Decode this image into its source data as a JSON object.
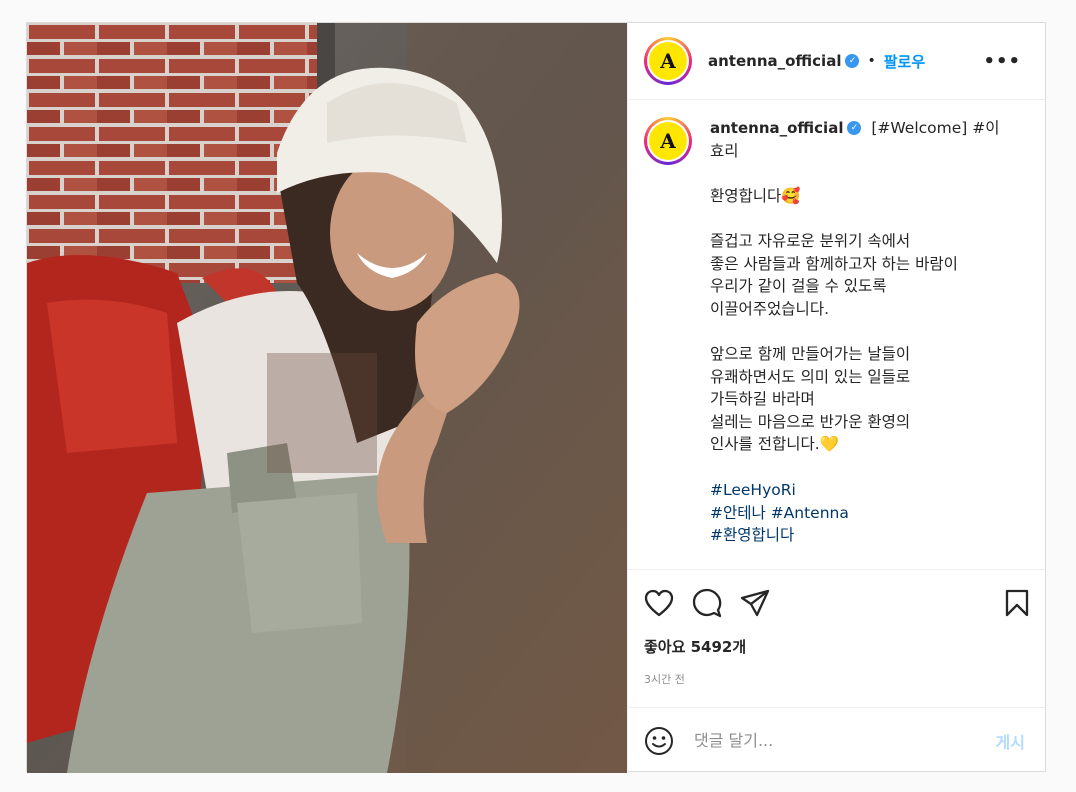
{
  "header": {
    "username": "antenna_official",
    "verified_mark": "✓",
    "separator": "•",
    "follow_label": "팔로우",
    "more_label": "•••",
    "avatar_letter": "A"
  },
  "caption": {
    "username": "antenna_official",
    "verified_mark": "✓",
    "text": "[#Welcome] #이효리\n\n환영합니다🥰\n\n즐겁고 자유로운 분위기 속에서\n좋은 사람들과 함께하고자 하는 바람이\n우리가 같이 걸을 수 있도록\n이끌어주었습니다.\n\n앞으로 함께 만들어가는 날들이\n유쾌하면서도 의미 있는 일들로\n가득하길 바라며\n설레는 마음으로 반가운 환영의\n인사를 전합니다.💛",
    "hashtags": [
      "#LeeHyoRi",
      "#안테나 #Antenna",
      "#환영합니다"
    ]
  },
  "actions": {
    "likes": "좋아요 5492개",
    "time": "3시간 전"
  },
  "comment": {
    "placeholder": "댓글 달기...",
    "post_label": "게시"
  },
  "icons": {
    "like": "heart-icon",
    "comment": "comment-icon",
    "share": "share-icon",
    "save": "bookmark-icon",
    "emoji": "emoji-icon"
  },
  "colors": {
    "follow": "#0095f6",
    "post_disabled": "#b3dbff",
    "avatar_fill": "#ffe600",
    "hashtag": "#00376b"
  }
}
